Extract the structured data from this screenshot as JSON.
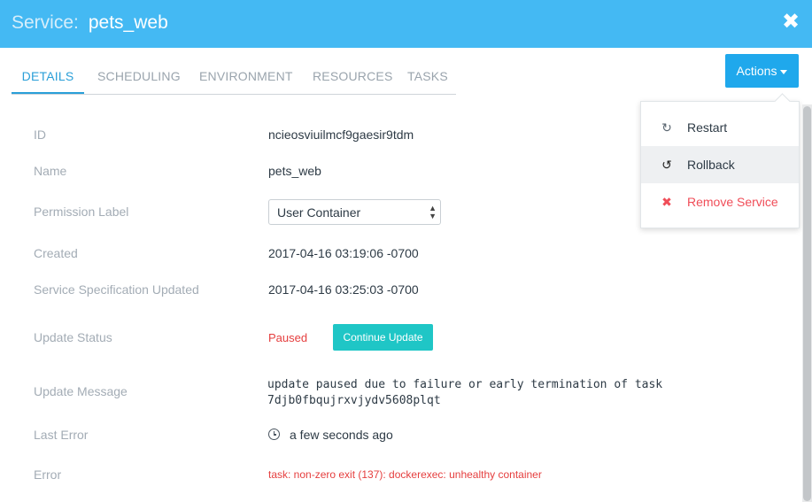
{
  "header": {
    "prefix": "Service:",
    "service_name": "pets_web",
    "close_icon": "close-icon"
  },
  "tabs": [
    {
      "label": "DETAILS",
      "active": true
    },
    {
      "label": "SCHEDULING",
      "active": false
    },
    {
      "label": "ENVIRONMENT",
      "active": false
    },
    {
      "label": "RESOURCES",
      "active": false
    },
    {
      "label": "TASKS",
      "active": false
    }
  ],
  "actions": {
    "label": "Actions",
    "menu": [
      {
        "label": "Restart",
        "icon": "refresh-icon"
      },
      {
        "label": "Rollback",
        "icon": "undo-icon"
      },
      {
        "label": "Remove Service",
        "icon": "remove-icon"
      }
    ]
  },
  "details": {
    "id_label": "ID",
    "id_value": "ncieosviuilmcf9gaesir9tdm",
    "name_label": "Name",
    "name_value": "pets_web",
    "permission_label": "Permission Label",
    "permission_value": "User Container",
    "created_label": "Created",
    "created_value": "2017-04-16 03:19:06 -0700",
    "spec_updated_label": "Service Specification Updated",
    "spec_updated_value": "2017-04-16 03:25:03 -0700",
    "update_status_label": "Update Status",
    "update_status_value": "Paused",
    "continue_update_label": "Continue Update",
    "update_message_label": "Update Message",
    "update_message_line1": "update paused due to failure or early termination of task",
    "update_message_line2": "7djb0fbqujrxvjydv5608plqt",
    "last_error_label": "Last Error",
    "last_error_value": "a few seconds ago",
    "error_label": "Error",
    "error_value": "task: non-zero exit (137): dockerexec: unhealthy container"
  },
  "colors": {
    "header_bg": "#44b9f3",
    "accent": "#1fa8ec",
    "danger": "#e53e3e",
    "continue_button": "#1fc6c6"
  }
}
